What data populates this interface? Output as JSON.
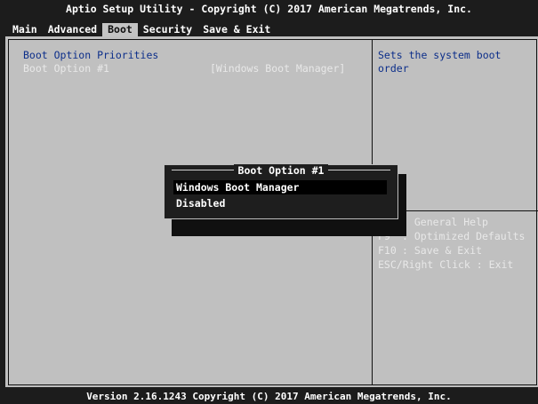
{
  "header": {
    "title": "Aptio Setup Utility - Copyright (C) 2017 American Megatrends, Inc."
  },
  "menu": [
    {
      "label": "Main"
    },
    {
      "label": "Advanced"
    },
    {
      "label": "Boot"
    },
    {
      "label": "Security"
    },
    {
      "label": "Save & Exit"
    }
  ],
  "main": {
    "section_title": "Boot Option Priorities",
    "boot_option": {
      "label": "Boot Option #1",
      "value": "[Windows Boot Manager]"
    }
  },
  "help": {
    "line1": "Sets the system boot",
    "line2": "order"
  },
  "keys": [
    {
      "key": "",
      "desc": ": General Help"
    },
    {
      "key": "F9",
      "desc": ": Optimized Defaults"
    },
    {
      "key": "F10",
      "desc": ": Save & Exit"
    },
    {
      "key": "ESC/Right Click",
      "desc": ": Exit"
    }
  ],
  "popup": {
    "title": "Boot Option #1",
    "options": [
      "Windows Boot Manager",
      "Disabled"
    ],
    "selected": "Windows Boot Manager"
  },
  "footer": {
    "version": "Version 2.16.1243 Copyright (C) 2017 American Megatrends, Inc."
  },
  "colors": {
    "panel": "#c0c0c0",
    "background": "#1c1c1c",
    "highlight_text": "#0c2e8a"
  }
}
